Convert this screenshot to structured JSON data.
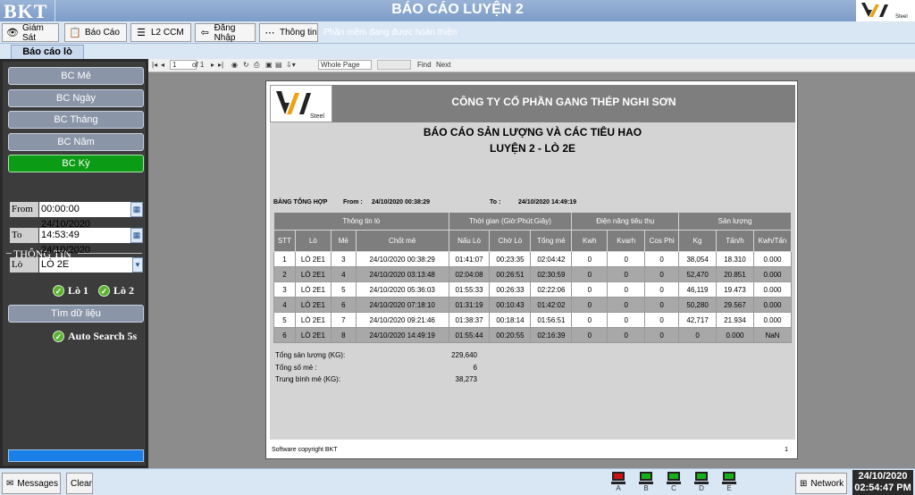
{
  "app": {
    "brand": "BKT",
    "title": "BÁO CÁO LUYỆN 2",
    "logo_text": "VAS",
    "logo_sub": "Steel"
  },
  "toolbar": {
    "buttons": [
      {
        "label": "Giám Sát",
        "icon": "eye-icon"
      },
      {
        "label": "Báo Cáo",
        "icon": "clipboard-icon"
      },
      {
        "label": "L2 CCM",
        "icon": "stack-icon"
      },
      {
        "label": "Đăng Nhập",
        "icon": "login-icon"
      },
      {
        "label": "Thông tin",
        "icon": "more-icon"
      }
    ],
    "status": "Phần mềm đang được hoàn thiện"
  },
  "tab": {
    "label": "Báo cáo lò"
  },
  "sidebar": {
    "buttons": [
      "BC  Mẻ",
      "BC Ngày",
      "BC Tháng",
      "BC Năm",
      "BC Kỳ"
    ],
    "group_title": "THÔNG TIN",
    "from_label": "From",
    "from_value": "00:00:00 24/10/2020",
    "to_label": "To",
    "to_value": "14:53:49 24/10/2020",
    "lo_label": "Lò",
    "lo_value": "LÒ 2E",
    "lo1": "Lò 1",
    "lo2": "Lò 2",
    "search_button": "Tìm dữ liệu",
    "auto_search": "Auto Search 5s"
  },
  "viewer": {
    "page_current": "1",
    "page_of": "of 1",
    "zoom": "Whole Page",
    "find": "Find",
    "next": "Next"
  },
  "report": {
    "company": "CÔNG TY CỔ PHẦN GANG THÉP NGHI SƠN",
    "title": "BÁO CÁO SẢN LƯỢNG VÀ CÁC TIÊU HAO",
    "subtitle": "LUYỆN 2 - LÒ 2E",
    "summary_label": "BẢNG TỔNG HỢP",
    "from_label": "From :",
    "from_value": "24/10/2020 00:38:29",
    "to_label": "To :",
    "to_value": "24/10/2020 14:49:19",
    "group_headers": [
      "Thông tin lò",
      "Thời gian (Giờ:Phút:Giây)",
      "Điện năng tiêu thụ",
      "Sản lượng"
    ],
    "columns": [
      "STT",
      "Lò",
      "Mẻ",
      "Chốt mẻ",
      "Nấu Lò",
      "Chờ Lò",
      "Tổng mẻ",
      "Kwh",
      "Kvarh",
      "Cos Phi",
      "Kg",
      "Tấn/h",
      "Kwh/Tấn"
    ],
    "rows": [
      [
        "1",
        "LÒ 2E1",
        "3",
        "24/10/2020 00:38:29",
        "01:41:07",
        "00:23:35",
        "02:04:42",
        "0",
        "0",
        "0",
        "38,054",
        "18.310",
        "0.000"
      ],
      [
        "2",
        "LÒ 2E1",
        "4",
        "24/10/2020 03:13:48",
        "02:04:08",
        "00:26:51",
        "02:30:59",
        "0",
        "0",
        "0",
        "52,470",
        "20.851",
        "0.000"
      ],
      [
        "3",
        "LÒ 2E1",
        "5",
        "24/10/2020 05:36:03",
        "01:55:33",
        "00:26:33",
        "02:22:06",
        "0",
        "0",
        "0",
        "46,119",
        "19.473",
        "0.000"
      ],
      [
        "4",
        "LÒ 2E1",
        "6",
        "24/10/2020 07:18:10",
        "01:31:19",
        "00:10:43",
        "01:42:02",
        "0",
        "0",
        "0",
        "50,280",
        "29.567",
        "0.000"
      ],
      [
        "5",
        "LÒ 2E1",
        "7",
        "24/10/2020 09:21:46",
        "01:38:37",
        "00:18:14",
        "01:56:51",
        "0",
        "0",
        "0",
        "42,717",
        "21.934",
        "0.000"
      ],
      [
        "6",
        "LÒ 2E1",
        "8",
        "24/10/2020 14:49:19",
        "01:55:44",
        "00:20:55",
        "02:16:39",
        "0",
        "0",
        "0",
        "0",
        "0.000",
        "NaN"
      ]
    ],
    "totals": [
      {
        "label": "Tổng sản lượng (KG):",
        "value": "229,640"
      },
      {
        "label": "Tổng số mẻ :",
        "value": "6"
      },
      {
        "label": "Trung bình mẻ (KG):",
        "value": "38,273"
      }
    ],
    "copyright": "Software copyright BKT",
    "page_number": "1"
  },
  "bottombar": {
    "messages": "Messages",
    "clear": "Clear",
    "stations": [
      {
        "label": "A",
        "color": "#d01010"
      },
      {
        "label": "B",
        "color": "#18b018"
      },
      {
        "label": "C",
        "color": "#18b018"
      },
      {
        "label": "D",
        "color": "#18b018"
      },
      {
        "label": "E",
        "color": "#18b018"
      }
    ],
    "network": "Network",
    "date": "24/10/2020",
    "time": "02:54:47 PM"
  }
}
